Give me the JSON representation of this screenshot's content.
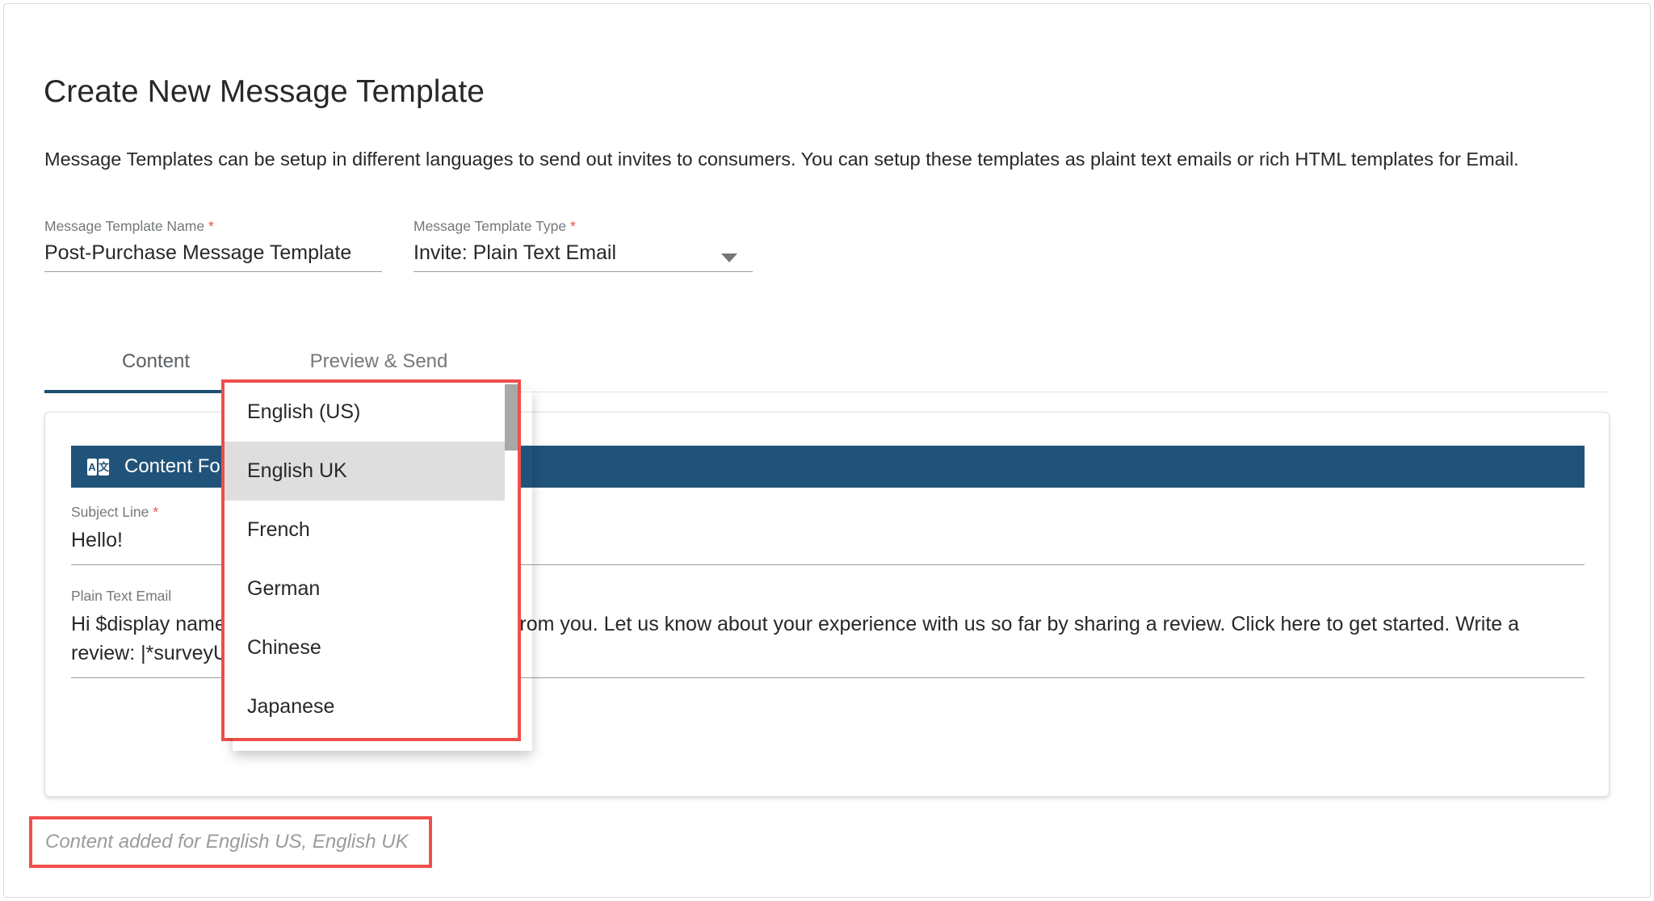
{
  "page": {
    "title": "Create New Message Template",
    "description": "Message Templates can be setup in different languages to send out invites to consumers. You can setup these templates as plaint text emails or rich HTML templates for Email."
  },
  "form": {
    "template_name": {
      "label": "Message Template Name",
      "required_mark": "*",
      "value": "Post-Purchase Message Template"
    },
    "template_type": {
      "label": "Message Template Type",
      "required_mark": "*",
      "value": "Invite: Plain Text Email",
      "arrow_icon": "chevron-down-icon"
    }
  },
  "tabs": [
    {
      "label": "Content",
      "active": true
    },
    {
      "label": "Preview & Send",
      "active": false
    }
  ],
  "content_card": {
    "language_bar": {
      "icon": "translate-icon",
      "icon_glyph_left": "A",
      "icon_glyph_right": "文",
      "label": "Content For",
      "background_color": "#21537a"
    },
    "subject": {
      "label": "Subject Line",
      "required_mark": "*",
      "value": "Hello!"
    },
    "body": {
      "label": "Plain Text Email",
      "value": "Hi $display name, have a sec? We’d love to hear from you. Let us know about your experience with us so far by sharing a review. Click here to get started. Write a review: |*surveyURL*|"
    }
  },
  "language_dropdown": {
    "highlight_color": "#dedede",
    "border_color": "#ef4f4a",
    "items": [
      {
        "label": "English (US)",
        "highlighted": false
      },
      {
        "label": "English UK",
        "highlighted": true
      },
      {
        "label": "French",
        "highlighted": false
      },
      {
        "label": "German",
        "highlighted": false
      },
      {
        "label": "Chinese",
        "highlighted": false
      },
      {
        "label": "Japanese",
        "highlighted": false
      }
    ]
  },
  "status_note": {
    "text": "Content added for English US, English UK",
    "border_color": "#ef4f4a"
  }
}
